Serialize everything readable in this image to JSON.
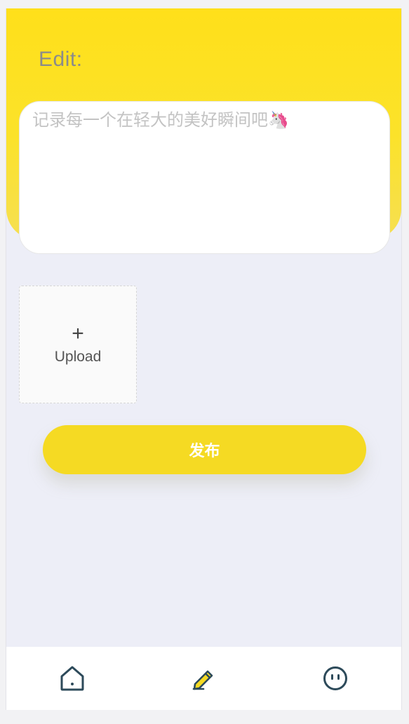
{
  "header": {
    "title": "Edit:"
  },
  "editor": {
    "placeholder": "记录每一个在轻大的美好瞬间吧🦄"
  },
  "upload": {
    "plus": "+",
    "label": "Upload"
  },
  "actions": {
    "publish_label": "发布"
  },
  "tabbar": {
    "items": [
      {
        "icon": "home-icon"
      },
      {
        "icon": "pencil-icon"
      },
      {
        "icon": "face-icon"
      }
    ],
    "active_index": 1
  },
  "colors": {
    "accent_yellow": "#f5da23",
    "header_yellow": "#ffe01a",
    "icon_dark": "#2d4a5a",
    "background": "#edeef7"
  }
}
